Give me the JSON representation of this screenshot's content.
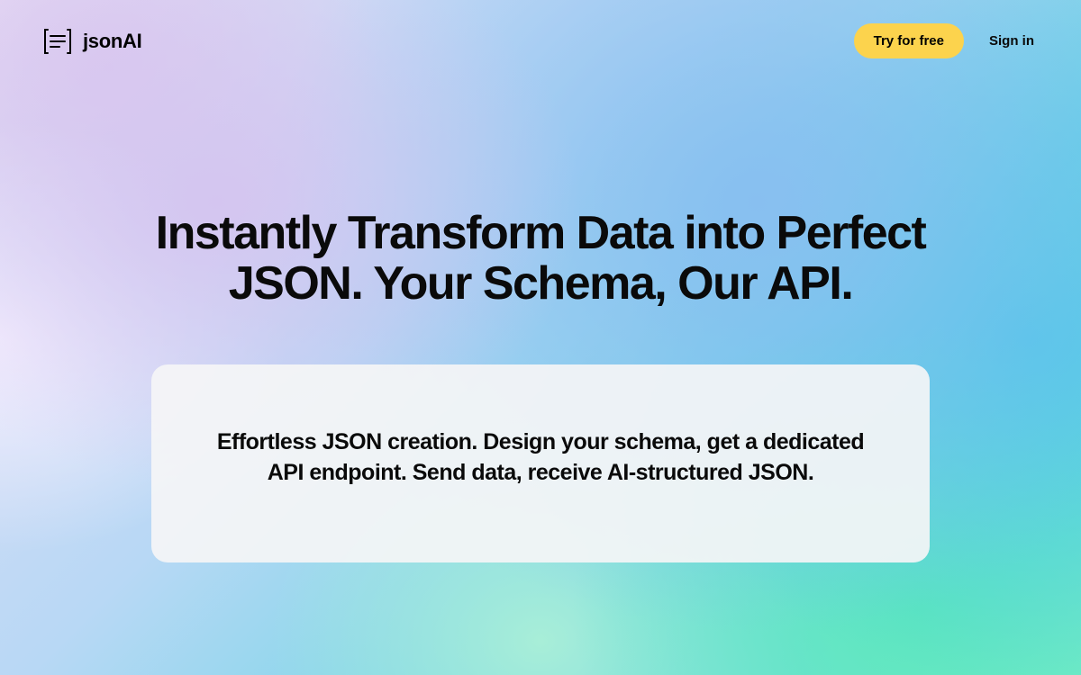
{
  "header": {
    "brand": "jsonAI",
    "cta_primary": "Try for free",
    "sign_in": "Sign in"
  },
  "hero": {
    "title": "Instantly Transform Data into Perfect JSON. Your Schema, Our API."
  },
  "card": {
    "text": "Effortless JSON creation. Design your schema, get a dedicated API endpoint. Send data, receive AI-structured JSON."
  },
  "colors": {
    "cta_bg": "#fcd34d",
    "text_primary": "#0a0a0a"
  }
}
